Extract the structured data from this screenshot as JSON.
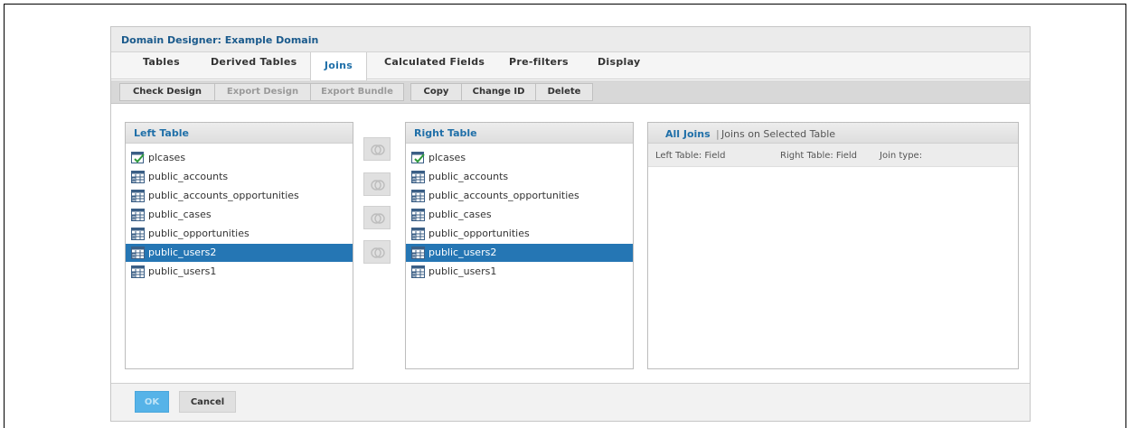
{
  "dialog": {
    "title": "Domain Designer: Example Domain"
  },
  "tabs": [
    {
      "label": "Tables",
      "active": false
    },
    {
      "label": "Derived Tables",
      "active": false
    },
    {
      "label": "Joins",
      "active": true
    },
    {
      "label": "Calculated Fields",
      "active": false
    },
    {
      "label": "Pre-filters",
      "active": false
    },
    {
      "label": "Display",
      "active": false
    }
  ],
  "toolbar": {
    "check_design": "Check Design",
    "export_design": "Export Design",
    "export_bundle": "Export Bundle",
    "copy": "Copy",
    "change_id": "Change ID",
    "delete": "Delete"
  },
  "left_table": {
    "title": "Left Table",
    "selected": "public_users2",
    "items": [
      {
        "label": "plcases",
        "icon": "derived-table-icon"
      },
      {
        "label": "public_accounts",
        "icon": "table-icon"
      },
      {
        "label": "public_accounts_opportunities",
        "icon": "table-icon"
      },
      {
        "label": "public_cases",
        "icon": "table-icon"
      },
      {
        "label": "public_opportunities",
        "icon": "table-icon"
      },
      {
        "label": "public_users2",
        "icon": "table-icon"
      },
      {
        "label": "public_users1",
        "icon": "table-icon"
      }
    ]
  },
  "right_table": {
    "title": "Right Table",
    "selected": "public_users2",
    "items": [
      {
        "label": "plcases",
        "icon": "derived-table-icon"
      },
      {
        "label": "public_accounts",
        "icon": "table-icon"
      },
      {
        "label": "public_accounts_opportunities",
        "icon": "table-icon"
      },
      {
        "label": "public_cases",
        "icon": "table-icon"
      },
      {
        "label": "public_opportunities",
        "icon": "table-icon"
      },
      {
        "label": "public_users2",
        "icon": "table-icon"
      },
      {
        "label": "public_users1",
        "icon": "table-icon"
      }
    ]
  },
  "join_buttons": [
    "inner-join-icon",
    "left-outer-join-icon",
    "right-outer-join-icon",
    "full-outer-join-icon"
  ],
  "joins_panel": {
    "all_joins": "All Joins",
    "separator": "|",
    "on_selected": "Joins on Selected Table",
    "columns": [
      "Left Table: Field",
      "Right Table: Field",
      "Join type:"
    ]
  },
  "footer": {
    "ok": "OK",
    "cancel": "Cancel"
  },
  "colors": {
    "accent": "#1f6fa8",
    "selected_row": "#2576b4",
    "ok_button": "#56b3e8"
  }
}
